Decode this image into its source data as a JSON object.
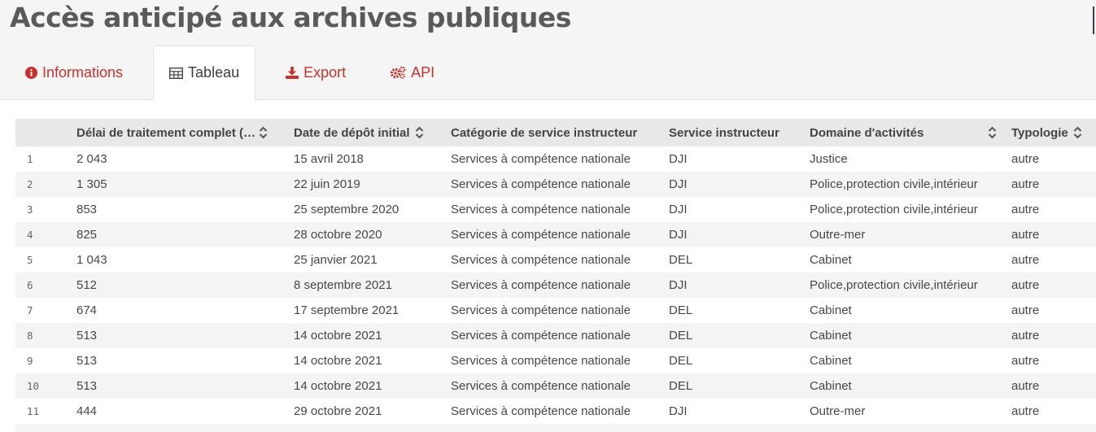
{
  "page": {
    "title": "Accès anticipé aux archives publiques"
  },
  "tabs": [
    {
      "label": "Informations",
      "icon": "info-circle-icon",
      "selected": false
    },
    {
      "label": "Tableau",
      "icon": "table-icon",
      "selected": true
    },
    {
      "label": "Export",
      "icon": "download-icon",
      "selected": false
    },
    {
      "label": "API",
      "icon": "cogs-icon",
      "selected": false
    }
  ],
  "colors": {
    "accent": "#c8312b",
    "title": "#5a5a5a",
    "header_bg": "#e8e8e8",
    "stripe": "#f4f4f4"
  },
  "table": {
    "columns": [
      {
        "label": "Délai de traitement complet (…",
        "sortable": true
      },
      {
        "label": "Date de dépôt initial",
        "sortable": true
      },
      {
        "label": "Catégorie de service instructeur",
        "sortable": false
      },
      {
        "label": "Service instructeur",
        "sortable": false
      },
      {
        "label": "Domaine d'activités",
        "sortable": true
      },
      {
        "label": "Typologie",
        "sortable": true
      }
    ],
    "rows": [
      {
        "n": "1",
        "delai": "2 043",
        "date": "15 avril 2018",
        "categorie": "Services à compétence nationale",
        "service": "DJI",
        "domaine": "Justice",
        "typologie": "autre"
      },
      {
        "n": "2",
        "delai": "1 305",
        "date": "22 juin 2019",
        "categorie": "Services à compétence nationale",
        "service": "DJI",
        "domaine": "Police,protection civile,intérieur",
        "typologie": "autre"
      },
      {
        "n": "3",
        "delai": "853",
        "date": "25 septembre 2020",
        "categorie": "Services à compétence nationale",
        "service": "DJI",
        "domaine": "Police,protection civile,intérieur",
        "typologie": "autre"
      },
      {
        "n": "4",
        "delai": "825",
        "date": "28 octobre 2020",
        "categorie": "Services à compétence nationale",
        "service": "DJI",
        "domaine": "Outre-mer",
        "typologie": "autre"
      },
      {
        "n": "5",
        "delai": "1 043",
        "date": "25 janvier 2021",
        "categorie": "Services à compétence nationale",
        "service": "DEL",
        "domaine": "Cabinet",
        "typologie": "autre"
      },
      {
        "n": "6",
        "delai": "512",
        "date": "8 septembre 2021",
        "categorie": "Services à compétence nationale",
        "service": "DJI",
        "domaine": "Police,protection civile,intérieur",
        "typologie": "autre"
      },
      {
        "n": "7",
        "delai": "674",
        "date": "17 septembre 2021",
        "categorie": "Services à compétence nationale",
        "service": "DEL",
        "domaine": "Cabinet",
        "typologie": "autre"
      },
      {
        "n": "8",
        "delai": "513",
        "date": "14 octobre 2021",
        "categorie": "Services à compétence nationale",
        "service": "DEL",
        "domaine": "Cabinet",
        "typologie": "autre"
      },
      {
        "n": "9",
        "delai": "513",
        "date": "14 octobre 2021",
        "categorie": "Services à compétence nationale",
        "service": "DEL",
        "domaine": "Cabinet",
        "typologie": "autre"
      },
      {
        "n": "10",
        "delai": "513",
        "date": "14 octobre 2021",
        "categorie": "Services à compétence nationale",
        "service": "DEL",
        "domaine": "Cabinet",
        "typologie": "autre"
      },
      {
        "n": "11",
        "delai": "444",
        "date": "29 octobre 2021",
        "categorie": "Services à compétence nationale",
        "service": "DJI",
        "domaine": "Outre-mer",
        "typologie": "autre"
      }
    ]
  }
}
